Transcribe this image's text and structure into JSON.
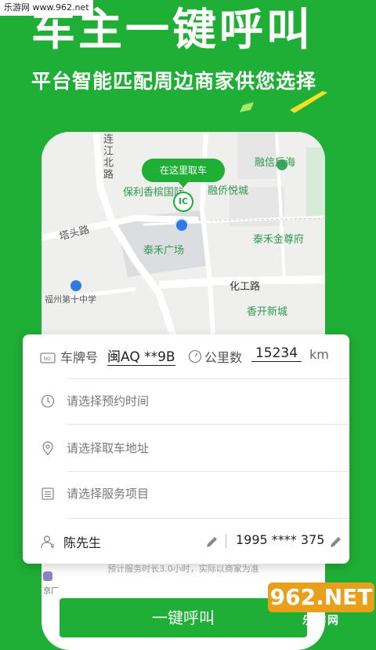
{
  "watermark_top": "乐游网 www.962.net",
  "hero": {
    "title": "车主一键呼叫",
    "subtitle": "平台智能匹配周边商家供您选择"
  },
  "map": {
    "pickup_bubble": "在这里取车",
    "pin_logo_text": "IC",
    "labels": {
      "lianjiang": "连江北路",
      "rongxin": "融信后海",
      "poly": "保利香槟国际",
      "rongqiao": "融侨悦城",
      "tatou": "塔头路",
      "taihe_guangchang": "泰禾广场",
      "taihe_jin": "泰禾金尊府",
      "fuzhou_school": "福州第十中学",
      "huagong": "化工路",
      "xiangkai": "香开新城"
    }
  },
  "form": {
    "plate_label": "车牌号",
    "plate_value": "闽AQ **9B",
    "km_label": "公里数",
    "km_value": "15234",
    "km_unit": "km",
    "time_placeholder": "请选择预约时间",
    "address_placeholder": "请选择取车地址",
    "service_placeholder": "请选择服务项目",
    "contact_name": "陈先生",
    "contact_phone": "1995 **** 375"
  },
  "note": "预计服务时长3.0小时，实际以商家为准",
  "partial_label": "京厂",
  "cta_label": "一键呼叫",
  "watermark_br": {
    "number": "962.NET",
    "text": "乐游网"
  },
  "colors": {
    "brand_green": "#1fae36",
    "location_blue": "#2f7be0",
    "stripe_yellow": "#f1e224"
  }
}
